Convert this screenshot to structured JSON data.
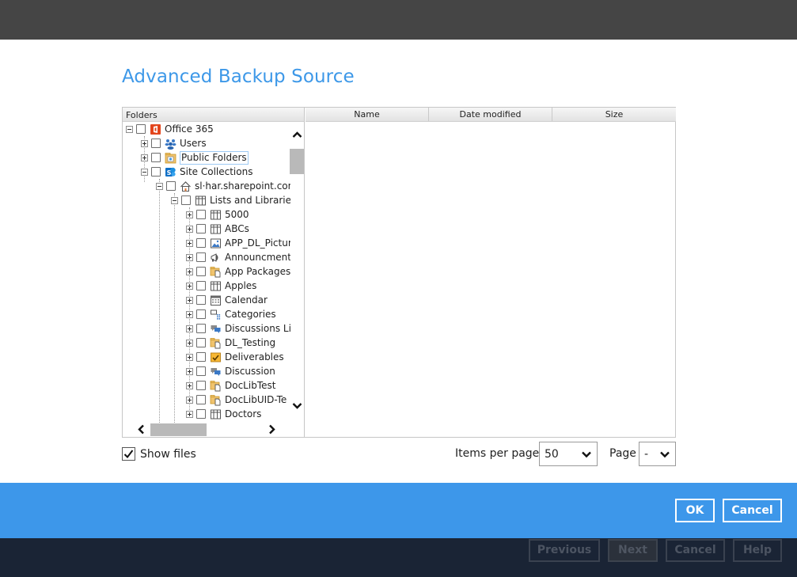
{
  "dialog": {
    "title": "Advanced Backup Source"
  },
  "tree": {
    "header": "Folders",
    "nodes": [
      {
        "label": "Office 365",
        "icon": "office365-icon",
        "checked": false
      },
      {
        "label": "Users",
        "icon": "users-icon",
        "checked": false
      },
      {
        "label": "Public Folders",
        "icon": "public-folder-icon",
        "checked": false
      },
      {
        "label": "Site Collections",
        "icon": "sharepoint-icon",
        "checked": false
      },
      {
        "label": "sl·har.sharepoint.com",
        "icon": "home-site-icon",
        "checked": false
      },
      {
        "label": "Lists and Libraries",
        "icon": "list-icon",
        "checked": false
      },
      {
        "label": "5000",
        "icon": "list-icon",
        "checked": false
      },
      {
        "label": "ABCs",
        "icon": "list-icon",
        "checked": false
      },
      {
        "label": "APP_DL_Pictur",
        "icon": "picture-library-icon",
        "checked": false
      },
      {
        "label": "Announcment",
        "icon": "announcement-icon",
        "checked": false
      },
      {
        "label": "App Packages",
        "icon": "document-library-icon",
        "checked": false
      },
      {
        "label": "Apples",
        "icon": "list-icon",
        "checked": false
      },
      {
        "label": "Calendar",
        "icon": "calendar-icon",
        "checked": false
      },
      {
        "label": "Categories",
        "icon": "categories-icon",
        "checked": false
      },
      {
        "label": "Discussions Li",
        "icon": "discussion-icon",
        "checked": false
      },
      {
        "label": "DL_Testing",
        "icon": "document-library-icon",
        "checked": false
      },
      {
        "label": "Deliverables",
        "icon": "deliverables-icon",
        "checked": false
      },
      {
        "label": "Discussion",
        "icon": "discussion-icon",
        "checked": false
      },
      {
        "label": "DocLibTest",
        "icon": "document-library-icon",
        "checked": false
      },
      {
        "label": "DocLibUID-Te",
        "icon": "document-library-icon",
        "checked": false
      },
      {
        "label": "Doctors",
        "icon": "list-icon",
        "checked": false
      }
    ]
  },
  "files": {
    "columns": [
      "Name",
      "Date modified",
      "Size"
    ]
  },
  "options": {
    "show_files_label": "Show files",
    "show_files_checked": true,
    "items_per_page_label": "Items per page",
    "items_per_page_value": "50",
    "page_label": "Page",
    "page_value": "-"
  },
  "dialog_buttons": {
    "ok": "OK",
    "cancel": "Cancel"
  },
  "wizard_buttons": {
    "previous": "Previous",
    "next": "Next",
    "cancel": "Cancel",
    "help": "Help"
  },
  "colors": {
    "accent": "#3d97ea",
    "title": "#3d98e8",
    "footer": "#1a2435",
    "topbar": "#454545"
  }
}
